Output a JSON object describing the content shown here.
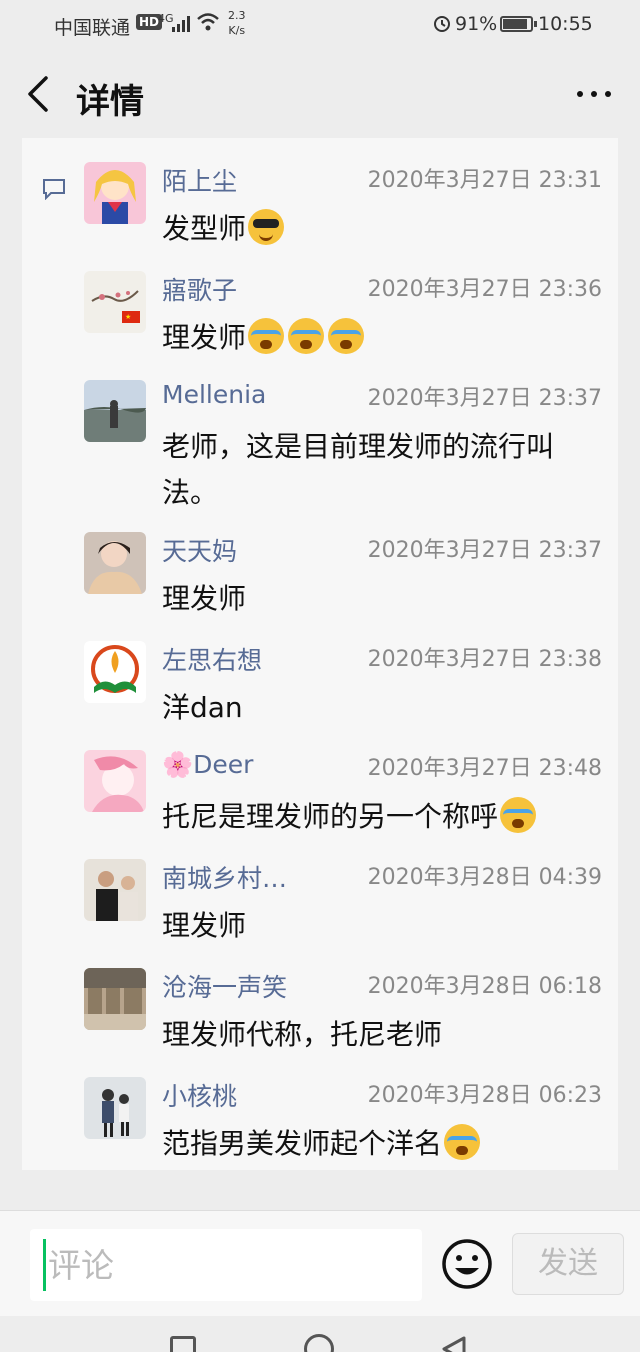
{
  "status_bar": {
    "carrier": "中国联通",
    "hd": "HD",
    "network": "4G",
    "speed_value": "2.3",
    "speed_unit": "K/s",
    "battery_percent": "91%",
    "battery_level": 0.91,
    "time": "10:55"
  },
  "nav": {
    "title": "详情",
    "back_icon": "chevron-left-icon",
    "more_icon": "more-dots-icon"
  },
  "comments": [
    {
      "name": "陌上尘",
      "time": "2020年3月27日 23:31",
      "text": "发型师",
      "emojis": [
        "cool"
      ]
    },
    {
      "name": "寤歌子",
      "time": "2020年3月27日 23:36",
      "text": "理发师",
      "emojis": [
        "cry",
        "cry",
        "cry"
      ]
    },
    {
      "name": "Mellenia",
      "time": "2020年3月27日 23:37",
      "text": "老师，这是目前理发师的流行叫法。",
      "emojis": []
    },
    {
      "name": "天天妈",
      "time": "2020年3月27日 23:37",
      "text": "理发师",
      "emojis": []
    },
    {
      "name": "左思右想",
      "time": "2020年3月27日 23:38",
      "text": "洋dan",
      "emojis": []
    },
    {
      "name": "🌸Deer",
      "time": "2020年3月27日 23:48",
      "text": "托尼是理发师的另一个称呼",
      "emojis": [
        "cry"
      ]
    },
    {
      "name": "南城乡村…",
      "time": "2020年3月28日 04:39",
      "text": "理发师",
      "emojis": []
    },
    {
      "name": "沧海一声笑",
      "time": "2020年3月28日 06:18",
      "text": "理发师代称，托尼老师",
      "emojis": []
    },
    {
      "name": "小核桃",
      "time": "2020年3月28日 06:23",
      "text": "范指男美发师起个洋名",
      "emojis": [
        "cry"
      ]
    }
  ],
  "input": {
    "placeholder": "评论"
  },
  "send_button": {
    "label": "发送"
  },
  "colors": {
    "name": "#576b95",
    "accent": "#07c160",
    "time": "#888888"
  }
}
